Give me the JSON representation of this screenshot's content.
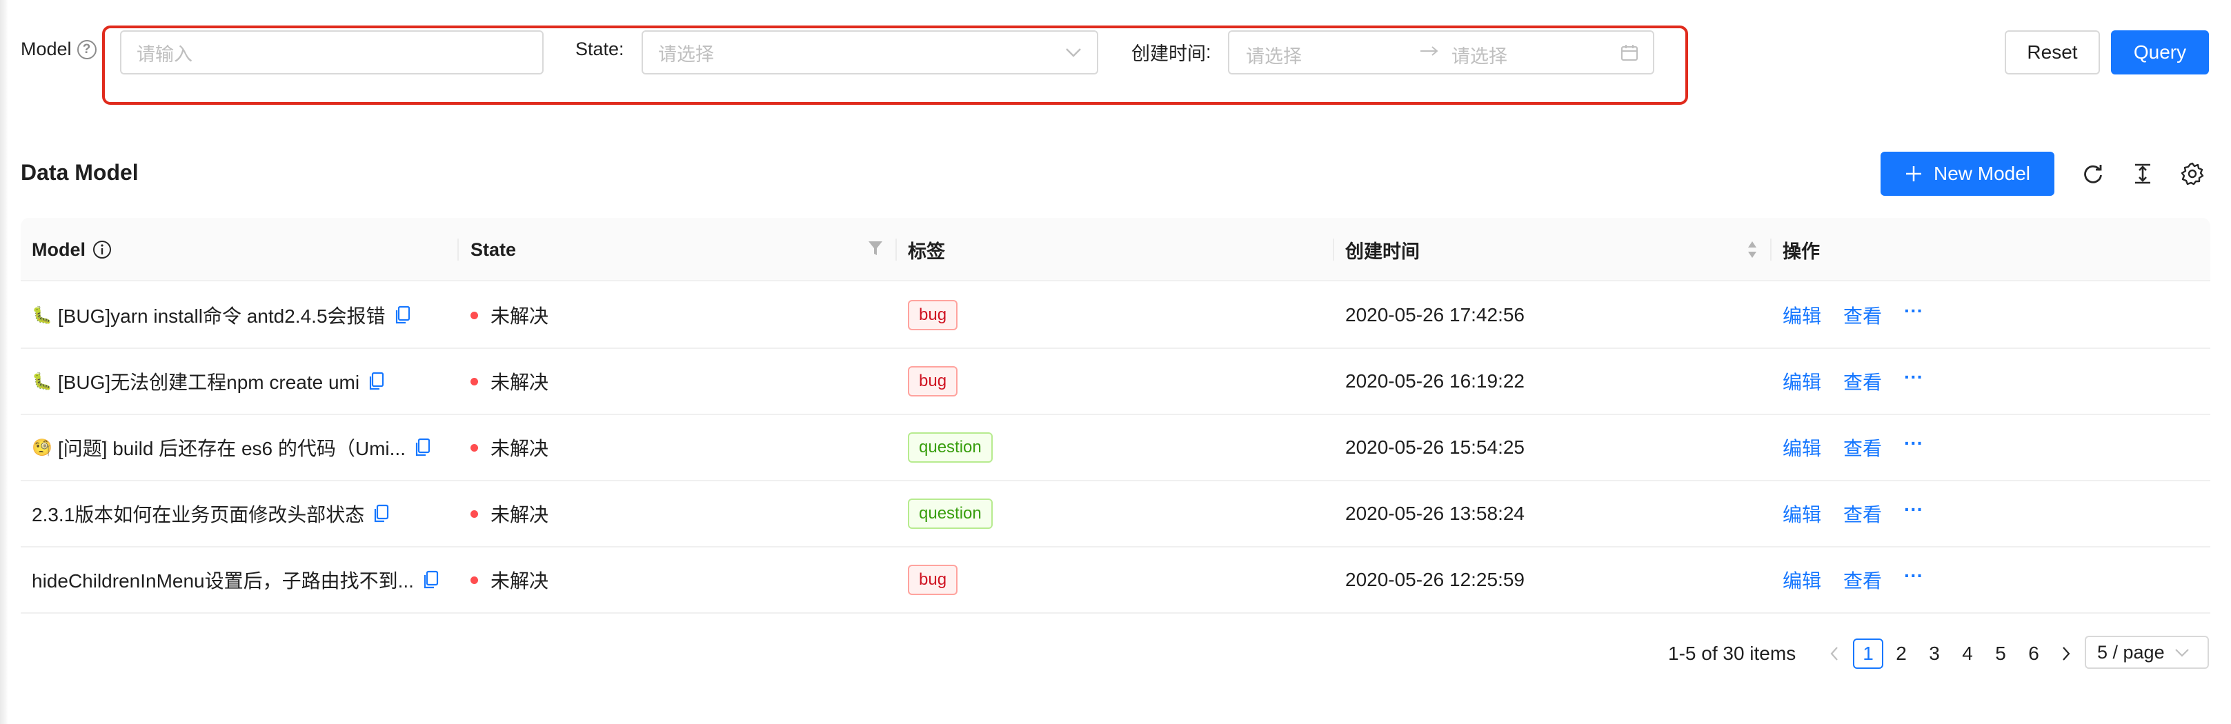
{
  "search": {
    "model_label": "Model",
    "model_placeholder": "请输入",
    "state_label": "State",
    "state_placeholder": "请选择",
    "created_label": "创建时间",
    "created_start_placeholder": "请选择",
    "created_end_placeholder": "请选择",
    "reset_label": "Reset",
    "query_label": "Query"
  },
  "toolbar": {
    "title": "Data Model",
    "new_label": "New Model",
    "icons": [
      "reload-icon",
      "column-height-icon",
      "setting-icon"
    ]
  },
  "table": {
    "columns": [
      "Model",
      "State",
      "标签",
      "创建时间",
      "操作"
    ],
    "rows": [
      {
        "emoji": "🐛",
        "model": "[BUG]yarn install命令 antd2.4.5会报错",
        "state": "未解决",
        "tag": "bug",
        "created": "2020-05-26 17:42:56",
        "edit": "编辑",
        "view": "查看",
        "more": "···"
      },
      {
        "emoji": "🐛",
        "model": "[BUG]无法创建工程npm create umi",
        "state": "未解决",
        "tag": "bug",
        "created": "2020-05-26 16:19:22",
        "edit": "编辑",
        "view": "查看",
        "more": "···"
      },
      {
        "emoji": "🧐",
        "model": "[问题] build 后还存在 es6 的代码（Umi...",
        "state": "未解决",
        "tag": "question",
        "created": "2020-05-26 15:54:25",
        "edit": "编辑",
        "view": "查看",
        "more": "···"
      },
      {
        "emoji": "",
        "model": "2.3.1版本如何在业务页面修改头部状态",
        "state": "未解决",
        "tag": "question",
        "created": "2020-05-26 13:58:24",
        "edit": "编辑",
        "view": "查看",
        "more": "···"
      },
      {
        "emoji": "",
        "model": "hideChildrenInMenu设置后，子路由找不到...",
        "state": "未解决",
        "tag": "bug",
        "created": "2020-05-26 12:25:59",
        "edit": "编辑",
        "view": "查看",
        "more": "···"
      }
    ]
  },
  "pagination": {
    "total_text": "1-5 of 30 items",
    "prev": "<",
    "next": ">",
    "pages": [
      "1",
      "2",
      "3",
      "4",
      "5",
      "6"
    ],
    "current": "1",
    "page_size": "5 / page"
  },
  "colors": {
    "primary": "#1677ff",
    "highlight": "#e02b1d",
    "status_dot": "#ff4d4f"
  }
}
